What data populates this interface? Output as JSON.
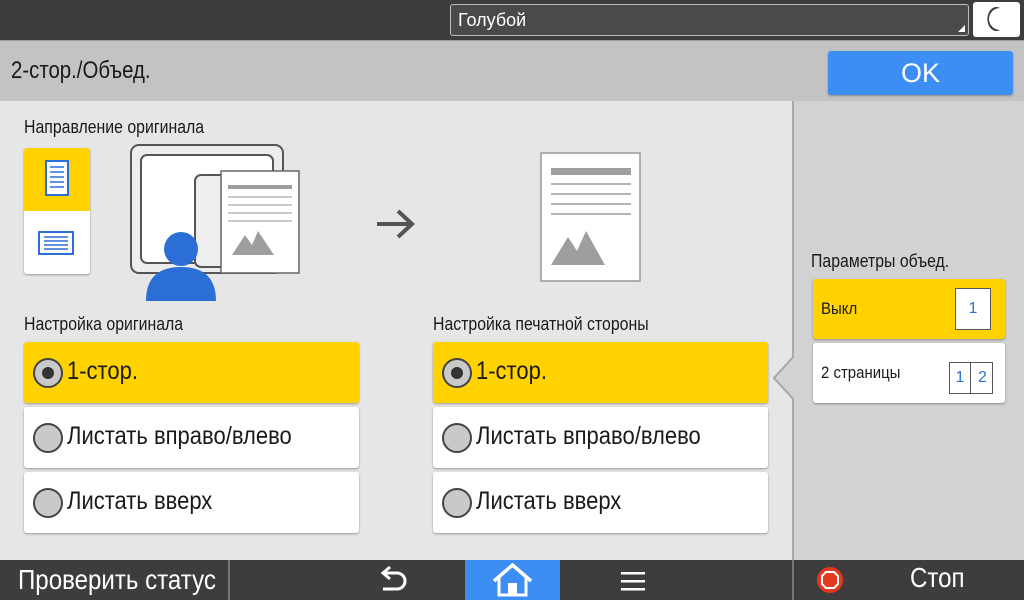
{
  "topbar": {
    "theme_value": "Голубой"
  },
  "header": {
    "title": "2-стор./Объед.",
    "ok_label": "OK"
  },
  "original_direction": {
    "label": "Направление оригинала",
    "options": [
      "portrait",
      "landscape"
    ],
    "selected": "portrait"
  },
  "original_settings": {
    "label": "Настройка оригинала",
    "options": [
      {
        "label": "1-стор.",
        "selected": true
      },
      {
        "label": "Листать вправо/влево",
        "selected": false
      },
      {
        "label": "Листать вверх",
        "selected": false
      }
    ]
  },
  "print_side_settings": {
    "label": "Настройка печатной стороны",
    "options": [
      {
        "label": "1-стор.",
        "selected": true
      },
      {
        "label": "Листать вправо/влево",
        "selected": false
      },
      {
        "label": "Листать вверх",
        "selected": false
      }
    ]
  },
  "combine": {
    "label": "Параметры объед.",
    "options": [
      {
        "label": "Выкл",
        "pages": [
          "1"
        ],
        "selected": true
      },
      {
        "label": "2 страницы",
        "pages": [
          "1",
          "2"
        ],
        "selected": false
      }
    ]
  },
  "bottombar": {
    "status_label": "Проверить статус",
    "stop_label": "Стоп"
  },
  "colors": {
    "accent_blue": "#3d8ef4",
    "selected_yellow": "#ffd200",
    "bar_dark": "#3d3d3d",
    "header_gray": "#c3c3c3",
    "stop_red": "#e2391f"
  },
  "icons": [
    "moon-icon",
    "portrait-orientation-icon",
    "landscape-orientation-icon",
    "scanner-illustration",
    "arrow-right-icon",
    "output-page-illustration",
    "back-icon",
    "home-icon",
    "menu-icon",
    "stop-icon"
  ]
}
